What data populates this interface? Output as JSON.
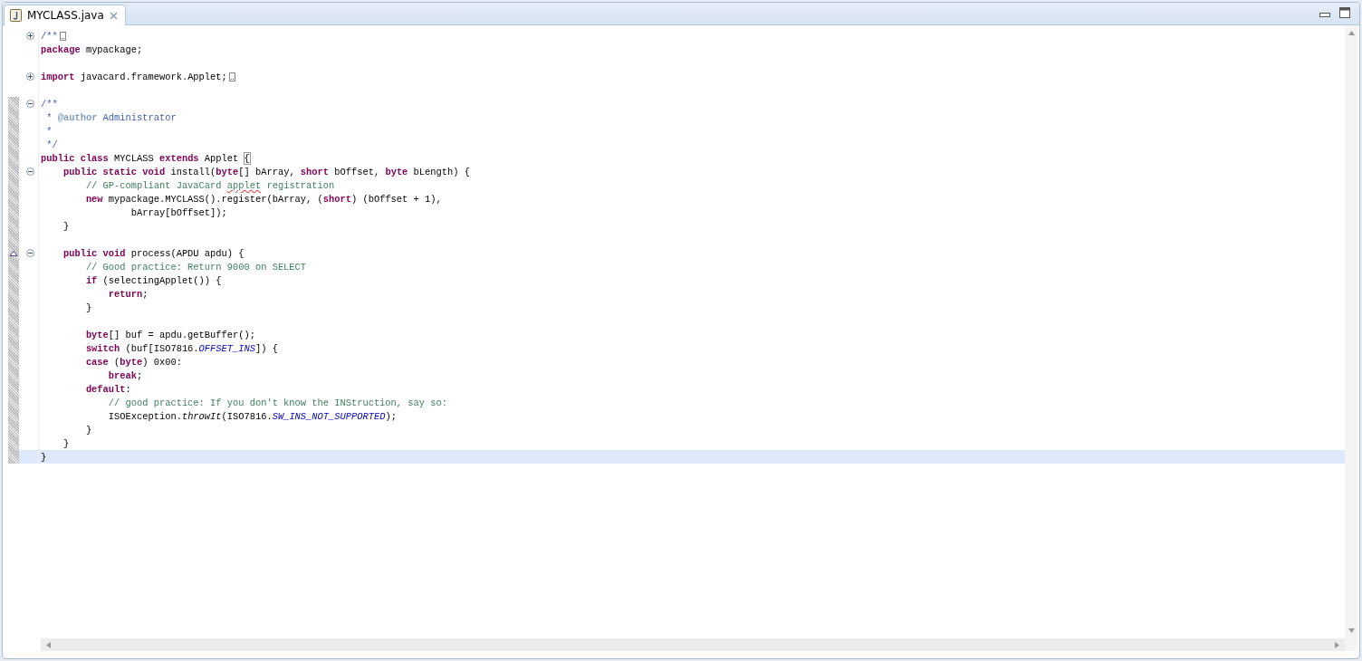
{
  "tab": {
    "label": "MYCLASS.java",
    "selected": true
  },
  "lines": [
    {
      "fold": {
        "expanded": false
      },
      "folded": true,
      "changed": false,
      "current": false,
      "override": false,
      "segments": [
        {
          "kind": "javadoc",
          "text": "/**"
        }
      ]
    },
    {
      "folded": false,
      "changed": false,
      "current": false,
      "override": false,
      "segments": [
        {
          "kind": "keyword",
          "text": "package"
        },
        {
          "kind": "plain",
          "text": " mypackage;"
        }
      ]
    },
    {
      "folded": false,
      "changed": false,
      "current": false,
      "override": false
    },
    {
      "fold": {
        "expanded": false
      },
      "folded": true,
      "changed": false,
      "current": false,
      "override": false,
      "segments": [
        {
          "kind": "keyword",
          "text": "import"
        },
        {
          "kind": "plain",
          "text": " javacard.framework.Applet;"
        }
      ]
    },
    {
      "folded": false,
      "changed": false,
      "current": false,
      "override": false
    },
    {
      "fold": {
        "expanded": true
      },
      "folded": false,
      "changed": true,
      "current": false,
      "override": false,
      "segments": [
        {
          "kind": "javadoc",
          "text": "/**"
        }
      ]
    },
    {
      "folded": false,
      "changed": true,
      "current": false,
      "override": false,
      "segments": [
        {
          "kind": "javadoc",
          "text": " * "
        },
        {
          "kind": "javadoc-tag",
          "text": "@author"
        },
        {
          "kind": "javadoc",
          "text": " Administrator"
        }
      ]
    },
    {
      "folded": false,
      "changed": true,
      "current": false,
      "override": false,
      "segments": [
        {
          "kind": "javadoc",
          "text": " *"
        }
      ]
    },
    {
      "folded": false,
      "changed": true,
      "current": false,
      "override": false,
      "segments": [
        {
          "kind": "javadoc",
          "text": " */"
        }
      ]
    },
    {
      "folded": false,
      "changed": true,
      "current": false,
      "override": false,
      "segments": [
        {
          "kind": "keyword",
          "text": "public class"
        },
        {
          "kind": "plain",
          "text": " MYCLASS "
        },
        {
          "kind": "keyword",
          "text": "extends"
        },
        {
          "kind": "plain",
          "text": " Applet "
        },
        {
          "kind": "bracket-match",
          "text": "{"
        }
      ]
    },
    {
      "fold": {
        "expanded": true
      },
      "folded": false,
      "changed": true,
      "current": false,
      "override": false,
      "segments": [
        {
          "kind": "keyword",
          "text": "    public static void"
        },
        {
          "kind": "plain",
          "text": " install("
        },
        {
          "kind": "keyword",
          "text": "byte"
        },
        {
          "kind": "plain",
          "text": "[] bArray, "
        },
        {
          "kind": "keyword",
          "text": "short"
        },
        {
          "kind": "plain",
          "text": " bOffset, "
        },
        {
          "kind": "keyword",
          "text": "byte"
        },
        {
          "kind": "plain",
          "text": " bLength) {"
        }
      ]
    },
    {
      "folded": false,
      "changed": true,
      "current": false,
      "override": false,
      "segments": [
        {
          "kind": "comment",
          "text": "        // GP-compliant JavaCard "
        },
        {
          "kind": "misspelled",
          "text": "applet"
        },
        {
          "kind": "comment",
          "text": " registration"
        }
      ]
    },
    {
      "folded": false,
      "changed": true,
      "current": false,
      "override": false,
      "segments": [
        {
          "kind": "keyword",
          "text": "        new"
        },
        {
          "kind": "plain",
          "text": " mypackage.MYCLASS().register(bArray, ("
        },
        {
          "kind": "keyword",
          "text": "short"
        },
        {
          "kind": "plain",
          "text": ") (bOffset + 1),"
        }
      ]
    },
    {
      "folded": false,
      "changed": true,
      "current": false,
      "override": false,
      "segments": [
        {
          "kind": "plain",
          "text": "                bArray[bOffset]);"
        }
      ]
    },
    {
      "folded": false,
      "changed": true,
      "current": false,
      "override": false,
      "segments": [
        {
          "kind": "plain",
          "text": "    }"
        }
      ]
    },
    {
      "folded": false,
      "changed": true,
      "current": false,
      "override": false
    },
    {
      "fold": {
        "expanded": true
      },
      "folded": false,
      "changed": true,
      "current": false,
      "override": true,
      "segments": [
        {
          "kind": "keyword",
          "text": "    public void"
        },
        {
          "kind": "plain",
          "text": " process(APDU apdu) {"
        }
      ]
    },
    {
      "folded": false,
      "changed": true,
      "current": false,
      "override": false,
      "segments": [
        {
          "kind": "comment",
          "text": "        // Good practice: Return 9000 on SELECT"
        }
      ]
    },
    {
      "folded": false,
      "changed": true,
      "current": false,
      "override": false,
      "segments": [
        {
          "kind": "keyword",
          "text": "        if"
        },
        {
          "kind": "plain",
          "text": " (selectingApplet()) {"
        }
      ]
    },
    {
      "folded": false,
      "changed": true,
      "current": false,
      "override": false,
      "segments": [
        {
          "kind": "keyword",
          "text": "            return"
        },
        {
          "kind": "plain",
          "text": ";"
        }
      ]
    },
    {
      "folded": false,
      "changed": true,
      "current": false,
      "override": false,
      "segments": [
        {
          "kind": "plain",
          "text": "        }"
        }
      ]
    },
    {
      "folded": false,
      "changed": true,
      "current": false,
      "override": false
    },
    {
      "folded": false,
      "changed": true,
      "current": false,
      "override": false,
      "segments": [
        {
          "kind": "keyword",
          "text": "        byte"
        },
        {
          "kind": "plain",
          "text": "[] buf = apdu.getBuffer();"
        }
      ]
    },
    {
      "folded": false,
      "changed": true,
      "current": false,
      "override": false,
      "segments": [
        {
          "kind": "keyword",
          "text": "        switch"
        },
        {
          "kind": "plain",
          "text": " (buf[ISO7816."
        },
        {
          "kind": "constant",
          "text": "OFFSET_INS"
        },
        {
          "kind": "plain",
          "text": "]) {"
        }
      ]
    },
    {
      "folded": false,
      "changed": true,
      "current": false,
      "override": false,
      "segments": [
        {
          "kind": "keyword",
          "text": "        case"
        },
        {
          "kind": "plain",
          "text": " ("
        },
        {
          "kind": "keyword",
          "text": "byte"
        },
        {
          "kind": "plain",
          "text": ") 0x00:"
        }
      ]
    },
    {
      "folded": false,
      "changed": true,
      "current": false,
      "override": false,
      "segments": [
        {
          "kind": "keyword",
          "text": "            break"
        },
        {
          "kind": "plain",
          "text": ";"
        }
      ]
    },
    {
      "folded": false,
      "changed": true,
      "current": false,
      "override": false,
      "segments": [
        {
          "kind": "keyword",
          "text": "        default"
        },
        {
          "kind": "plain",
          "text": ":"
        }
      ]
    },
    {
      "folded": false,
      "changed": true,
      "current": false,
      "override": false,
      "segments": [
        {
          "kind": "comment",
          "text": "            // good practice: If you don't know the INStruction, say so:"
        }
      ]
    },
    {
      "folded": false,
      "changed": true,
      "current": false,
      "override": false,
      "segments": [
        {
          "kind": "plain",
          "text": "            ISOException."
        },
        {
          "kind": "static-method",
          "text": "throwIt"
        },
        {
          "kind": "plain",
          "text": "(ISO7816."
        },
        {
          "kind": "constant",
          "text": "SW_INS_NOT_SUPPORTED"
        },
        {
          "kind": "plain",
          "text": ");"
        }
      ]
    },
    {
      "folded": false,
      "changed": true,
      "current": false,
      "override": false,
      "segments": [
        {
          "kind": "plain",
          "text": "        }"
        }
      ]
    },
    {
      "folded": false,
      "changed": true,
      "current": false,
      "override": false,
      "segments": [
        {
          "kind": "plain",
          "text": "    }"
        }
      ]
    },
    {
      "folded": false,
      "changed": true,
      "current": true,
      "override": false,
      "segments": [
        {
          "kind": "plain",
          "text": "}"
        }
      ]
    }
  ]
}
